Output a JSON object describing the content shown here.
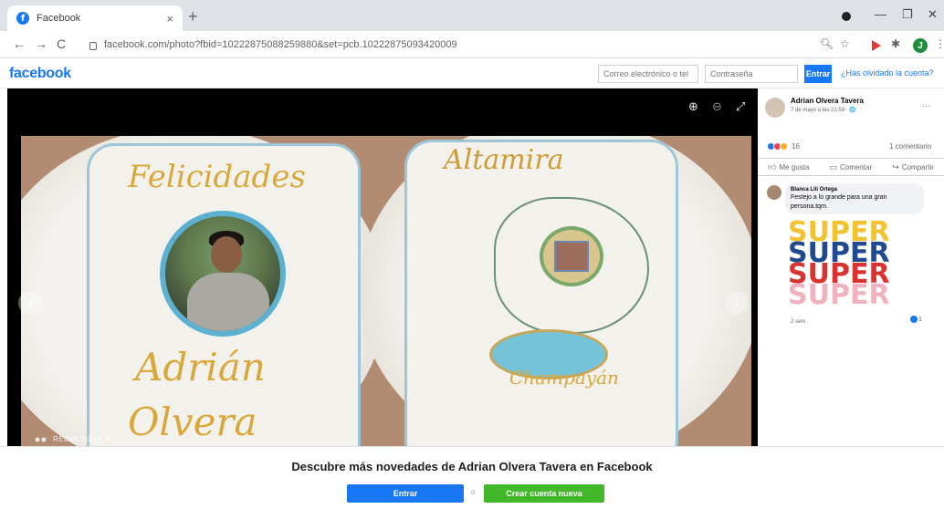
{
  "browser": {
    "tab_title": "Facebook",
    "tab_close": "×",
    "new_tab": "+",
    "url": "facebook.com/photo?fbid=10222875088259880&set=pcb.10222875093420009",
    "profile_initial": "J"
  },
  "header": {
    "logo": "facebook",
    "email_placeholder": "Correo electrónico o tel",
    "password_placeholder": "Contraseña",
    "login_label": "Entrar",
    "forgot_label": "¿Has olvidado la cuenta?"
  },
  "photo": {
    "watermark": "REDMI NOTE 8",
    "cake_left": {
      "line1": "Felicidades",
      "line2": "Adrián",
      "line3": "Olvera"
    },
    "cake_right": {
      "line1": "Altamira",
      "line2": "Champayán"
    }
  },
  "post": {
    "author": "Adrian Olvera Tavera",
    "date": "7 de mayo a las 21:58 · 🌐",
    "more": "···",
    "reaction_count": "16",
    "comment_count": "1 comentario",
    "actions": {
      "like": "Me gusta",
      "comment": "Comentar",
      "share": "Compartir"
    },
    "comment": {
      "author": "Blanca Lili Ortega",
      "text": "Festejo a lo grande para una gran persona.tqm.",
      "sticker_word": "SUPER",
      "time": "2 sem",
      "reactions": "1"
    }
  },
  "bottom": {
    "discover": "Descubre más novedades de Adrian Olvera Tavera en Facebook",
    "login_label": "Entrar",
    "or": "o",
    "create_label": "Crear cuenta nueva"
  },
  "colors": {
    "brand": "#1877f2",
    "create_green": "#42b72a",
    "sticker_yellow": "#f2c230",
    "sticker_blue": "#1f4a8f",
    "sticker_red": "#d8332f",
    "sticker_pink": "#f1b2bd"
  }
}
